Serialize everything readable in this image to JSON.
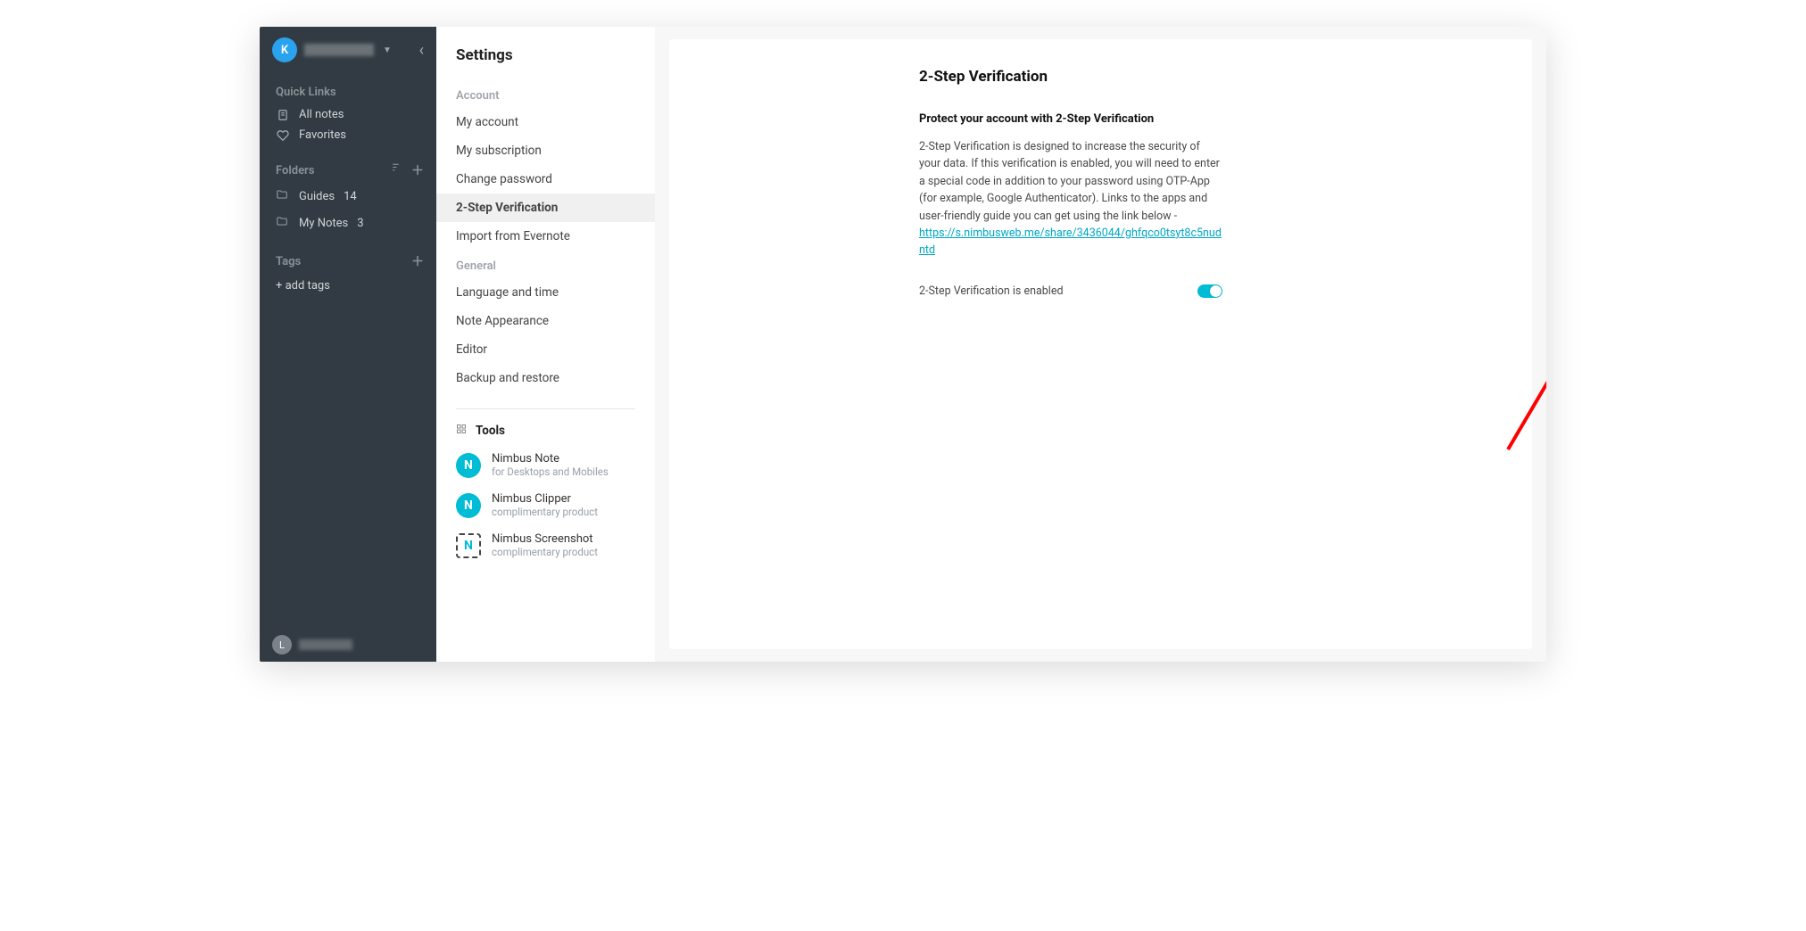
{
  "sidebar": {
    "avatar_letter": "K",
    "quick_links_label": "Quick Links",
    "all_notes": "All notes",
    "favorites": "Favorites",
    "folders_label": "Folders",
    "folders": [
      {
        "name": "Guides",
        "count": "14"
      },
      {
        "name": "My Notes",
        "count": "3"
      }
    ],
    "tags_label": "Tags",
    "add_tags": "+ add tags",
    "bottom_avatar": "L"
  },
  "settings": {
    "title": "Settings",
    "account_section": "Account",
    "account_items": [
      "My account",
      "My subscription",
      "Change password",
      "2-Step Verification",
      "Import from Evernote"
    ],
    "general_section": "General",
    "general_items": [
      "Language and time",
      "Note Appearance",
      "Editor",
      "Backup and restore"
    ],
    "tools_label": "Tools",
    "tools": [
      {
        "name": "Nimbus Note",
        "sub": "for Desktops and Mobiles"
      },
      {
        "name": "Nimbus Clipper",
        "sub": "complimentary product"
      },
      {
        "name": "Nimbus Screenshot",
        "sub": "complimentary product"
      }
    ]
  },
  "page": {
    "title": "2-Step Verification",
    "subhead": "Protect your account with 2-Step Verification",
    "body": "2-Step Verification is designed to increase the security of your data. If this verification is enabled, you will need to enter a special code in addition to your password using OTP-App (for example, Google Authenticator). Links to the apps and user-friendly guide you can get using the link below -",
    "link": "https://s.nimbusweb.me/share/3436044/ghfqco0tsyt8c5nudntd",
    "toggle_label": "2-Step Verification is enabled",
    "toggle_on": true
  }
}
